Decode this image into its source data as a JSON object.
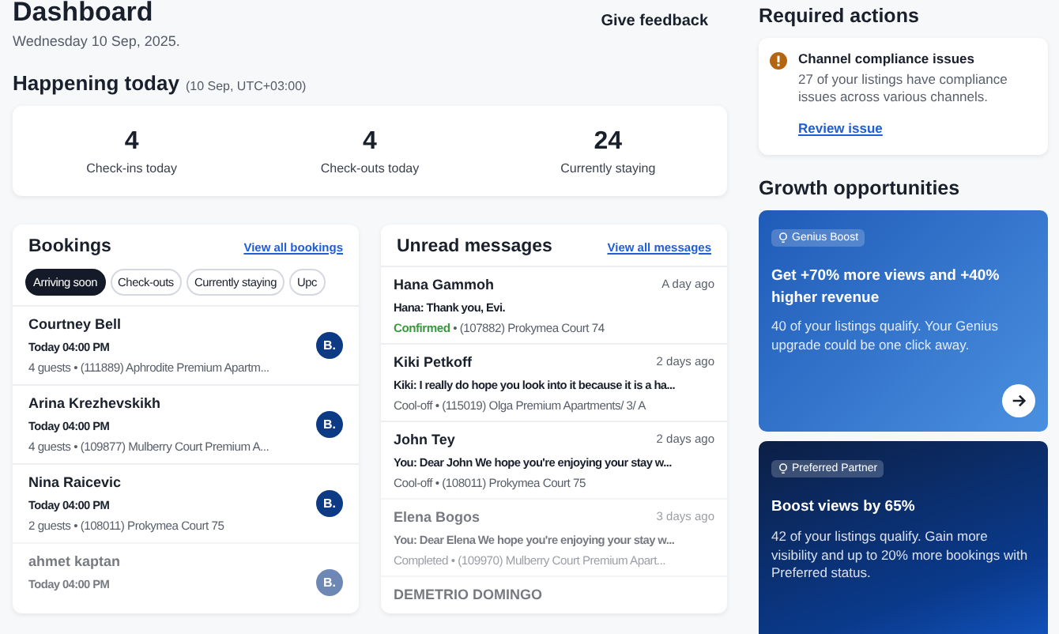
{
  "header": {
    "title": "Dashboard",
    "date": "Wednesday 10 Sep, 2025.",
    "feedback": "Give feedback"
  },
  "today": {
    "title": "Happening today",
    "note": "(10 Sep, UTC+03:00)",
    "stats": [
      {
        "value": "4",
        "label": "Check-ins today"
      },
      {
        "value": "4",
        "label": "Check-outs today"
      },
      {
        "value": "24",
        "label": "Currently staying"
      }
    ]
  },
  "bookings": {
    "title": "Bookings",
    "link": "View all bookings",
    "filters": [
      {
        "label": "Arriving soon",
        "selected": true
      },
      {
        "label": "Check-outs",
        "selected": false
      },
      {
        "label": "Currently staying",
        "selected": false
      },
      {
        "label": "Upc",
        "selected": false
      }
    ],
    "rows": [
      {
        "name": "Courtney Bell",
        "time": "Today 04:00 PM",
        "details": "4 guests • (111889) Aphrodite Premium Apartm...",
        "channel": "B.",
        "faded": false
      },
      {
        "name": "Arina Krezhevskikh",
        "time": "Today 04:00 PM",
        "details": "4 guests • (109877) Mulberry Court Premium A...",
        "channel": "B.",
        "faded": false
      },
      {
        "name": "Nina Raicevic",
        "time": "Today 04:00 PM",
        "details": "2 guests • (108011) Prokymea Court 75",
        "channel": "B.",
        "faded": false
      },
      {
        "name": "ahmet kaptan",
        "time": "Today 04:00 PM",
        "channel": "B.",
        "faded": true
      }
    ]
  },
  "messages": {
    "title": "Unread messages",
    "link": "View all messages",
    "rows": [
      {
        "name": "Hana Gammoh",
        "when": "A day ago",
        "text": "Hana: Thank you, Evi.",
        "status": "Confirmed",
        "kind": "confirmed",
        "details": "• (107882) Prokymea Court 74",
        "faded": false
      },
      {
        "name": "Kiki Petkoff",
        "when": "2 days ago",
        "text": "Kiki: I really do hope you look into it because it is a ha...",
        "status": "Cool-off",
        "kind": "other",
        "details": "• (115019) Olga Premium Apartments/ 3/ A",
        "faded": false
      },
      {
        "name": "John Tey",
        "when": "2 days ago",
        "text": "You: Dear John We hope you're enjoying your stay w...",
        "status": "Cool-off",
        "kind": "other",
        "details": "• (108011) Prokymea Court 75",
        "faded": false
      },
      {
        "name": "Elena Bogos",
        "when": "3 days ago",
        "text": "You: Dear Elena We hope you're enjoying your stay w...",
        "status": "Completed",
        "kind": "other",
        "details": "• (109970) Mulberry Court Premium Apart...",
        "faded": true
      },
      {
        "name": "DEMETRIO DOMINGO",
        "faded": true
      }
    ]
  },
  "required_actions": {
    "title": "Required actions",
    "items": [
      {
        "title": "Channel compliance issues",
        "text": "27 of your listings have compliance issues across various channels.",
        "link": "Review issue"
      }
    ]
  },
  "growth": {
    "title": "Growth opportunities",
    "cards": [
      {
        "tag": "Genius Boost",
        "title": "Get +70% more views and +40% higher revenue",
        "text": "40 of your listings qualify. Your Genius upgrade could be one click away.",
        "kind": "light",
        "arrow": true
      },
      {
        "tag": "Preferred Partner",
        "title": "Boost views by 65%",
        "text": "42 of your listings qualify. Gain more visibility and up to 20% more bookings with Preferred status.",
        "kind": "dark",
        "arrow": false
      }
    ]
  }
}
